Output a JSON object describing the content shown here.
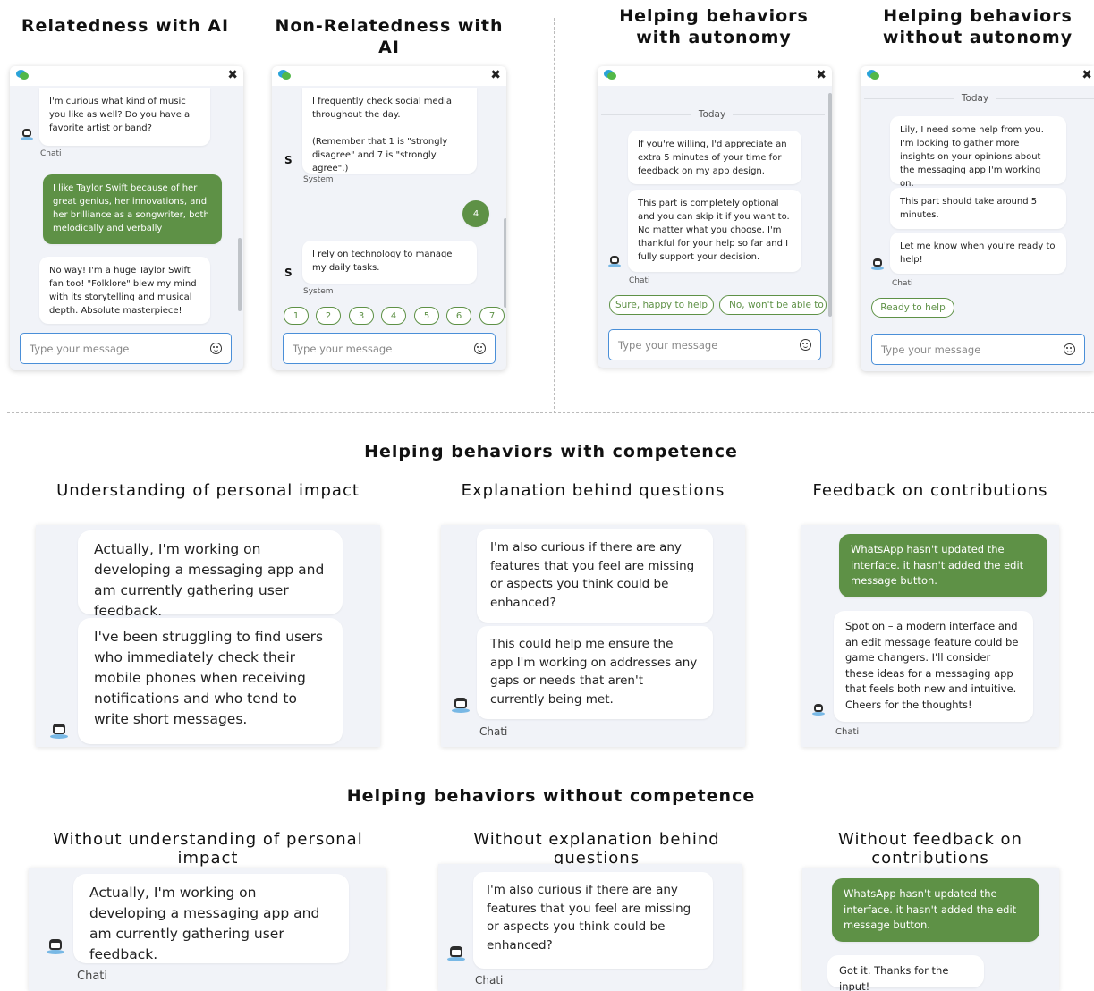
{
  "headings": {
    "relatedness": "Relatedness with AI",
    "non_relatedness": "Non-Relatedness with AI",
    "help_autonomy_1": "Helping behaviors",
    "help_autonomy_2": "with autonomy",
    "help_no_autonomy_1": "Helping behaviors",
    "help_no_autonomy_2": "without autonomy",
    "help_competence": "Helping behaviors with competence",
    "help_no_competence": "Helping behaviors without competence",
    "understanding": "Understanding of personal impact",
    "explanation": "Explanation behind questions",
    "feedback": "Feedback on contributions",
    "no_understanding": "Without understanding of personal impact",
    "no_explanation": "Without explanation behind questions",
    "no_feedback": "Without feedback on contributions"
  },
  "common": {
    "input_placeholder": "Type your message",
    "bot_name": "Chati",
    "system_name": "System",
    "system_initial": "S",
    "today": "Today",
    "close_glyph": "✖"
  },
  "relatedness_chat": {
    "msg1": "I'm curious what kind of music you like as well? Do you have a favorite artist or band?",
    "msg2": "I like Taylor Swift because of her great genius, her innovations, and her brilliance as a songwriter, both melodically and verbally",
    "msg3": "No way! I'm a huge Taylor Swift fan too! \"Folklore\" blew my mind with its storytelling and musical depth. Absolute masterpiece!"
  },
  "non_relatedness_chat": {
    "msg1a": "I frequently check social media throughout the day.",
    "msg1b": "(Remember that 1 is \"strongly disagree\" and 7 is \"strongly agree\".)",
    "answer": "4",
    "msg2": "I rely on technology to manage my daily tasks.",
    "scale": [
      "1",
      "2",
      "3",
      "4",
      "5",
      "6",
      "7"
    ]
  },
  "autonomy_chat": {
    "msg1": "If you're willing, I'd appreciate an extra 5 minutes of your time for feedback on my app design.",
    "msg2": "This part is completely optional and you can skip it if you want to. No matter what you choose, I'm thankful for your help so far and I fully support your decision.",
    "chip_yes": "Sure, happy to help",
    "chip_no": "No, won't be able to help"
  },
  "no_autonomy_chat": {
    "msg1": "Lily, I need some help from you. I'm looking to gather more insights on your opinions about the messaging app I'm working on.",
    "msg2": "This part should take around 5 minutes.",
    "msg3": "Let me know when you're ready to help!",
    "chip": "Ready to help"
  },
  "understanding_chat": {
    "msg1": "Actually, I'm working on developing a messaging app and am currently gathering user feedback.",
    "msg2": "I've been struggling to find users who immediately check their mobile phones when receiving notifications and who tend to write short messages."
  },
  "explanation_chat": {
    "msg1": "I'm also curious if there are any features that you feel are missing or aspects you think could be enhanced?",
    "msg2": "This could help me ensure the app I'm working on addresses any gaps or needs that aren't currently being met."
  },
  "feedback_chat": {
    "user_msg": "WhatsApp hasn't updated the interface. it hasn't added the edit message button.",
    "bot_msg": "Spot on – a modern interface and an edit message feature could be game changers. I'll consider these ideas for a messaging app that feels both new and intuitive. Cheers for the thoughts!"
  },
  "no_understanding_chat": {
    "msg1": "Actually, I'm working on developing a messaging app and am currently gathering user feedback."
  },
  "no_explanation_chat": {
    "msg1": "I'm also curious if there are any features that you feel are missing or aspects you think could be enhanced?"
  },
  "no_feedback_chat": {
    "user_msg": "WhatsApp hasn't updated the interface. it hasn't added the edit message button.",
    "bot_msg": "Got it. Thanks for the input!"
  },
  "colors": {
    "user_bubble": "#5e9146",
    "input_border": "#4a8fd8",
    "widget_bg": "#f1f3f8"
  }
}
